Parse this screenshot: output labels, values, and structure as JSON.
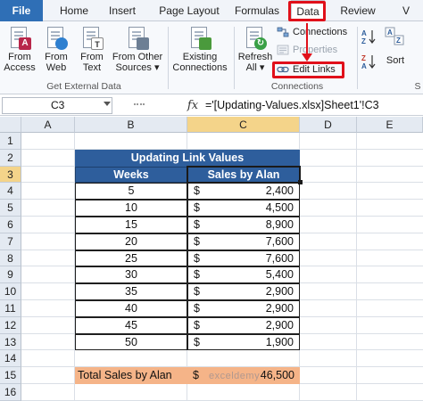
{
  "ribbon_tabs": {
    "file": "File",
    "home": "Home",
    "insert": "Insert",
    "page_layout": "Page Layout",
    "formulas": "Formulas",
    "data": "Data",
    "review": "Review",
    "view": "V"
  },
  "get_external_data": {
    "from_access": [
      "From",
      "Access"
    ],
    "from_web": [
      "From",
      "Web"
    ],
    "from_text": [
      "From",
      "Text"
    ],
    "from_other": [
      "From Other",
      "Sources ▾"
    ],
    "existing": [
      "Existing",
      "Connections"
    ],
    "group_label": "Get External Data"
  },
  "connections": {
    "refresh": [
      "Refresh",
      "All ▾"
    ],
    "connections": "Connections",
    "properties": "Properties",
    "edit_links": "Edit Links",
    "group_label": "Connections"
  },
  "sort_group": {
    "sort": "Sort",
    "group_label_partial": "S"
  },
  "formula_bar": {
    "name_box": "C3",
    "fx": "fx",
    "formula": "='[Updating-Values.xlsx]Sheet1'!C3"
  },
  "columns": [
    "A",
    "B",
    "C",
    "D",
    "E"
  ],
  "rows": [
    "1",
    "2",
    "3",
    "4",
    "5",
    "6",
    "7",
    "8",
    "9",
    "10",
    "11",
    "12",
    "13",
    "14",
    "15",
    "16"
  ],
  "sheet": {
    "title": "Updating Link Values",
    "headers": [
      "Weeks",
      "Sales by Alan"
    ],
    "currency": "$",
    "data": [
      {
        "week": "5",
        "sales": "2,400"
      },
      {
        "week": "10",
        "sales": "4,500"
      },
      {
        "week": "15",
        "sales": "8,900"
      },
      {
        "week": "20",
        "sales": "7,600"
      },
      {
        "week": "25",
        "sales": "7,600"
      },
      {
        "week": "30",
        "sales": "5,400"
      },
      {
        "week": "35",
        "sales": "2,900"
      },
      {
        "week": "40",
        "sales": "2,900"
      },
      {
        "week": "45",
        "sales": "2,900"
      },
      {
        "week": "50",
        "sales": "1,900"
      }
    ],
    "total_label": "Total Sales by Alan",
    "total_currency": "$",
    "total_value": "46,500"
  },
  "watermark": "exceldemy",
  "colors": {
    "header_blue": "#2e5e9c",
    "total_orange": "#f5b488",
    "highlight_red": "#e0101a",
    "file_tab": "#2f6fb6"
  }
}
